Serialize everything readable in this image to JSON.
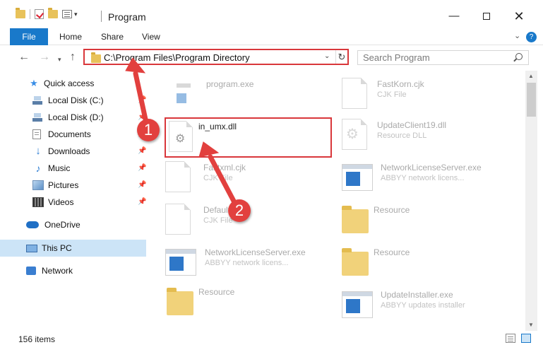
{
  "window": {
    "title": "Program",
    "minimize_glyph": "—",
    "close_glyph": "✕"
  },
  "ribbon": {
    "file_tab": "File",
    "tabs": [
      "Home",
      "Share",
      "View"
    ],
    "help_glyph": "?",
    "expand_glyph": "⌄"
  },
  "navbar": {
    "back_glyph": "←",
    "forward_glyph": "→",
    "recent_glyph": "▾",
    "up_glyph": "↑",
    "address": "C:\\Program Files\\Program Directory",
    "address_dropdown_glyph": "⌄",
    "refresh_glyph": "↻",
    "search_placeholder": "Search Program"
  },
  "sidebar": {
    "items": [
      {
        "label": "Quick access",
        "icon": "star-icon"
      },
      {
        "label": "Local Disk (C:)",
        "icon": "disk-icon",
        "pinned": true
      },
      {
        "label": "Local Disk (D:)",
        "icon": "disk-icon",
        "pinned": true
      },
      {
        "label": "Documents",
        "icon": "documents-icon",
        "pinned": true
      },
      {
        "label": "Downloads",
        "icon": "download-icon",
        "pinned": true
      },
      {
        "label": "Music",
        "icon": "music-icon",
        "pinned": true
      },
      {
        "label": "Pictures",
        "icon": "pictures-icon",
        "pinned": true
      },
      {
        "label": "Videos",
        "icon": "videos-icon",
        "pinned": true
      },
      {
        "label": "OneDrive",
        "icon": "onedrive-icon"
      },
      {
        "label": "This PC",
        "icon": "computer-icon",
        "selected": true
      },
      {
        "label": "Network",
        "icon": "network-icon"
      }
    ],
    "pin_glyph": "📌"
  },
  "files": [
    {
      "name": "program.exe",
      "desc": "",
      "icon": "exe-icon"
    },
    {
      "name": "FastKorn.cjk",
      "desc": "CJK File",
      "icon": "file-icon"
    },
    {
      "name": "in_umx.dll",
      "desc": "",
      "icon": "dll-icon",
      "highlighted": true
    },
    {
      "name": "UpdateClient19.dll",
      "desc": "Resource DLL",
      "icon": "dll-icon"
    },
    {
      "name": "Fastxml.cjk",
      "desc": "CJK File",
      "icon": "file-icon"
    },
    {
      "name": "NetworkLicenseServer.exe",
      "desc": "ABBYY network licens...",
      "icon": "app-icon"
    },
    {
      "name": "Default.cjk",
      "desc": "CJK File",
      "icon": "file-icon"
    },
    {
      "name": "Resource",
      "desc": "",
      "icon": "folder-icon"
    },
    {
      "name": "NetworkLicenseServer.exe",
      "desc": "ABBYY network licens...",
      "icon": "app-icon"
    },
    {
      "name": "Resource",
      "desc": "",
      "icon": "folder-icon"
    },
    {
      "name": "Resource",
      "desc": "",
      "icon": "folder-icon"
    },
    {
      "name": "UpdateInstaller.exe",
      "desc": "ABBYY updates installer",
      "icon": "app-icon"
    }
  ],
  "status": {
    "item_count": "156 items"
  },
  "annotations": {
    "step1": "1",
    "step2": "2",
    "accent_color": "#d9373b"
  }
}
